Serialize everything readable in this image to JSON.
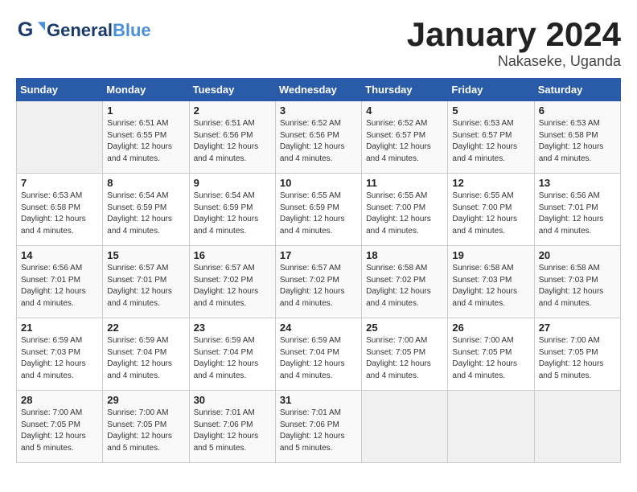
{
  "header": {
    "logo_general": "General",
    "logo_blue": "Blue",
    "month_title": "January 2024",
    "location": "Nakaseke, Uganda"
  },
  "weekdays": [
    "Sunday",
    "Monday",
    "Tuesday",
    "Wednesday",
    "Thursday",
    "Friday",
    "Saturday"
  ],
  "weeks": [
    [
      {
        "day": "",
        "info": ""
      },
      {
        "day": "1",
        "info": "Sunrise: 6:51 AM\nSunset: 6:55 PM\nDaylight: 12 hours\nand 4 minutes."
      },
      {
        "day": "2",
        "info": "Sunrise: 6:51 AM\nSunset: 6:56 PM\nDaylight: 12 hours\nand 4 minutes."
      },
      {
        "day": "3",
        "info": "Sunrise: 6:52 AM\nSunset: 6:56 PM\nDaylight: 12 hours\nand 4 minutes."
      },
      {
        "day": "4",
        "info": "Sunrise: 6:52 AM\nSunset: 6:57 PM\nDaylight: 12 hours\nand 4 minutes."
      },
      {
        "day": "5",
        "info": "Sunrise: 6:53 AM\nSunset: 6:57 PM\nDaylight: 12 hours\nand 4 minutes."
      },
      {
        "day": "6",
        "info": "Sunrise: 6:53 AM\nSunset: 6:58 PM\nDaylight: 12 hours\nand 4 minutes."
      }
    ],
    [
      {
        "day": "7",
        "info": "Sunrise: 6:53 AM\nSunset: 6:58 PM\nDaylight: 12 hours\nand 4 minutes."
      },
      {
        "day": "8",
        "info": "Sunrise: 6:54 AM\nSunset: 6:59 PM\nDaylight: 12 hours\nand 4 minutes."
      },
      {
        "day": "9",
        "info": "Sunrise: 6:54 AM\nSunset: 6:59 PM\nDaylight: 12 hours\nand 4 minutes."
      },
      {
        "day": "10",
        "info": "Sunrise: 6:55 AM\nSunset: 6:59 PM\nDaylight: 12 hours\nand 4 minutes."
      },
      {
        "day": "11",
        "info": "Sunrise: 6:55 AM\nSunset: 7:00 PM\nDaylight: 12 hours\nand 4 minutes."
      },
      {
        "day": "12",
        "info": "Sunrise: 6:55 AM\nSunset: 7:00 PM\nDaylight: 12 hours\nand 4 minutes."
      },
      {
        "day": "13",
        "info": "Sunrise: 6:56 AM\nSunset: 7:01 PM\nDaylight: 12 hours\nand 4 minutes."
      }
    ],
    [
      {
        "day": "14",
        "info": "Sunrise: 6:56 AM\nSunset: 7:01 PM\nDaylight: 12 hours\nand 4 minutes."
      },
      {
        "day": "15",
        "info": "Sunrise: 6:57 AM\nSunset: 7:01 PM\nDaylight: 12 hours\nand 4 minutes."
      },
      {
        "day": "16",
        "info": "Sunrise: 6:57 AM\nSunset: 7:02 PM\nDaylight: 12 hours\nand 4 minutes."
      },
      {
        "day": "17",
        "info": "Sunrise: 6:57 AM\nSunset: 7:02 PM\nDaylight: 12 hours\nand 4 minutes."
      },
      {
        "day": "18",
        "info": "Sunrise: 6:58 AM\nSunset: 7:02 PM\nDaylight: 12 hours\nand 4 minutes."
      },
      {
        "day": "19",
        "info": "Sunrise: 6:58 AM\nSunset: 7:03 PM\nDaylight: 12 hours\nand 4 minutes."
      },
      {
        "day": "20",
        "info": "Sunrise: 6:58 AM\nSunset: 7:03 PM\nDaylight: 12 hours\nand 4 minutes."
      }
    ],
    [
      {
        "day": "21",
        "info": "Sunrise: 6:59 AM\nSunset: 7:03 PM\nDaylight: 12 hours\nand 4 minutes."
      },
      {
        "day": "22",
        "info": "Sunrise: 6:59 AM\nSunset: 7:04 PM\nDaylight: 12 hours\nand 4 minutes."
      },
      {
        "day": "23",
        "info": "Sunrise: 6:59 AM\nSunset: 7:04 PM\nDaylight: 12 hours\nand 4 minutes."
      },
      {
        "day": "24",
        "info": "Sunrise: 6:59 AM\nSunset: 7:04 PM\nDaylight: 12 hours\nand 4 minutes."
      },
      {
        "day": "25",
        "info": "Sunrise: 7:00 AM\nSunset: 7:05 PM\nDaylight: 12 hours\nand 4 minutes."
      },
      {
        "day": "26",
        "info": "Sunrise: 7:00 AM\nSunset: 7:05 PM\nDaylight: 12 hours\nand 4 minutes."
      },
      {
        "day": "27",
        "info": "Sunrise: 7:00 AM\nSunset: 7:05 PM\nDaylight: 12 hours\nand 5 minutes."
      }
    ],
    [
      {
        "day": "28",
        "info": "Sunrise: 7:00 AM\nSunset: 7:05 PM\nDaylight: 12 hours\nand 5 minutes."
      },
      {
        "day": "29",
        "info": "Sunrise: 7:00 AM\nSunset: 7:05 PM\nDaylight: 12 hours\nand 5 minutes."
      },
      {
        "day": "30",
        "info": "Sunrise: 7:01 AM\nSunset: 7:06 PM\nDaylight: 12 hours\nand 5 minutes."
      },
      {
        "day": "31",
        "info": "Sunrise: 7:01 AM\nSunset: 7:06 PM\nDaylight: 12 hours\nand 5 minutes."
      },
      {
        "day": "",
        "info": ""
      },
      {
        "day": "",
        "info": ""
      },
      {
        "day": "",
        "info": ""
      }
    ]
  ]
}
